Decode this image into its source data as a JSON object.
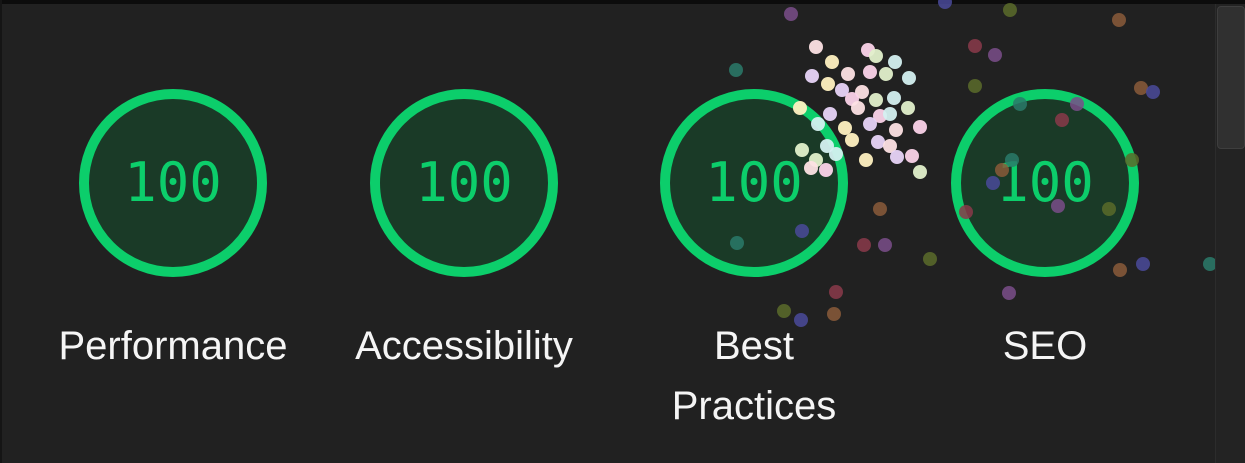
{
  "colors": {
    "background": "#212121",
    "pass_green": "#0cce6b",
    "ring_fill": "#1a3a27",
    "label_text": "#f5f5f5"
  },
  "gauges": [
    {
      "id": "performance",
      "score": "100",
      "label": "Performance"
    },
    {
      "id": "accessibility",
      "score": "100",
      "label": "Accessibility"
    },
    {
      "id": "best-practices",
      "score": "100",
      "label": "Best Practices"
    },
    {
      "id": "seo",
      "score": "100",
      "label": "SEO"
    }
  ],
  "score_fraction": [
    1,
    1,
    1,
    1
  ],
  "confetti_colors": [
    "#fde2e4",
    "#fbd3e9",
    "#e2f0cb",
    "#d4f0f0",
    "#fff1c1",
    "#e8d4f8",
    "#7a4e8a",
    "#5a6b2a",
    "#8a5a3a",
    "#4a4a9a",
    "#2a7a6a",
    "#8a3a4a"
  ]
}
